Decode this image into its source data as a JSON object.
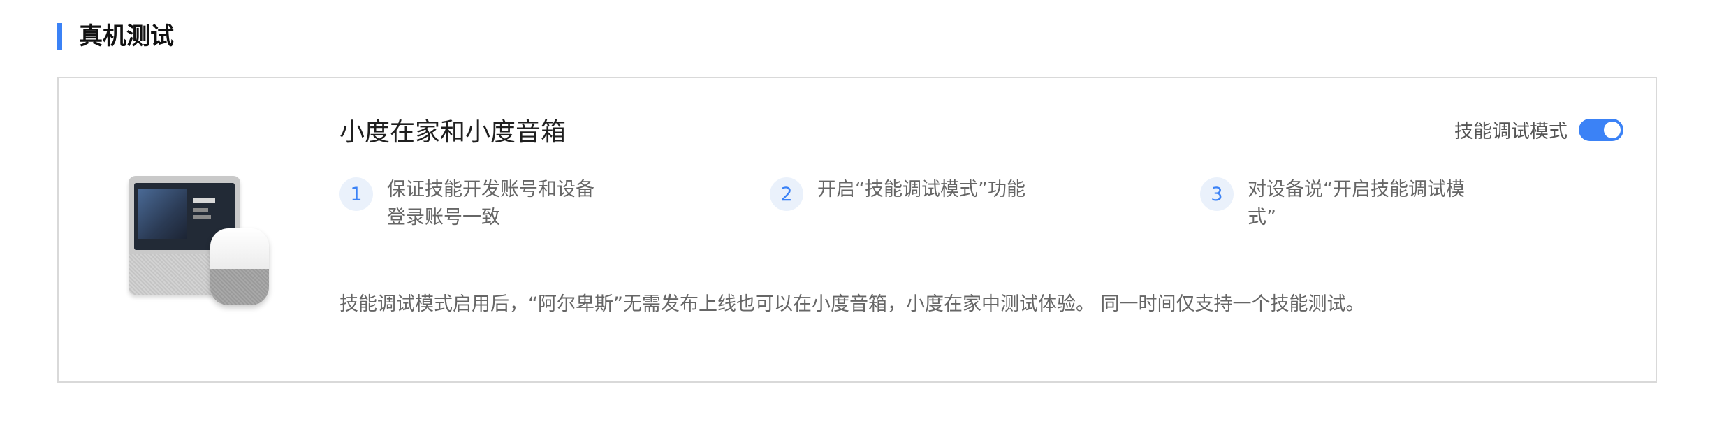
{
  "section": {
    "title": "真机测试",
    "accent_color": "#3b82f6"
  },
  "card": {
    "title": "小度在家和小度音箱",
    "device_image": "xiaodu-home-and-speaker-illustration",
    "toggle": {
      "label": "技能调试模式",
      "state": "on",
      "color": "#3b82f6"
    },
    "steps": [
      {
        "num": "1",
        "text_line1": "保证技能开发账号和设备",
        "text_line2": "登录账号一致"
      },
      {
        "num": "2",
        "text_line1": "开启“技能调试模式”功能",
        "text_line2": ""
      },
      {
        "num": "3",
        "text_line1": "对设备说“开启技能调试模",
        "text_line2": "式”"
      }
    ],
    "note": "技能调试模式启用后，“阿尔卑斯”无需发布上线也可以在小度音箱，小度在家中测试体验。 同一时间仅支持一个技能测试。"
  }
}
